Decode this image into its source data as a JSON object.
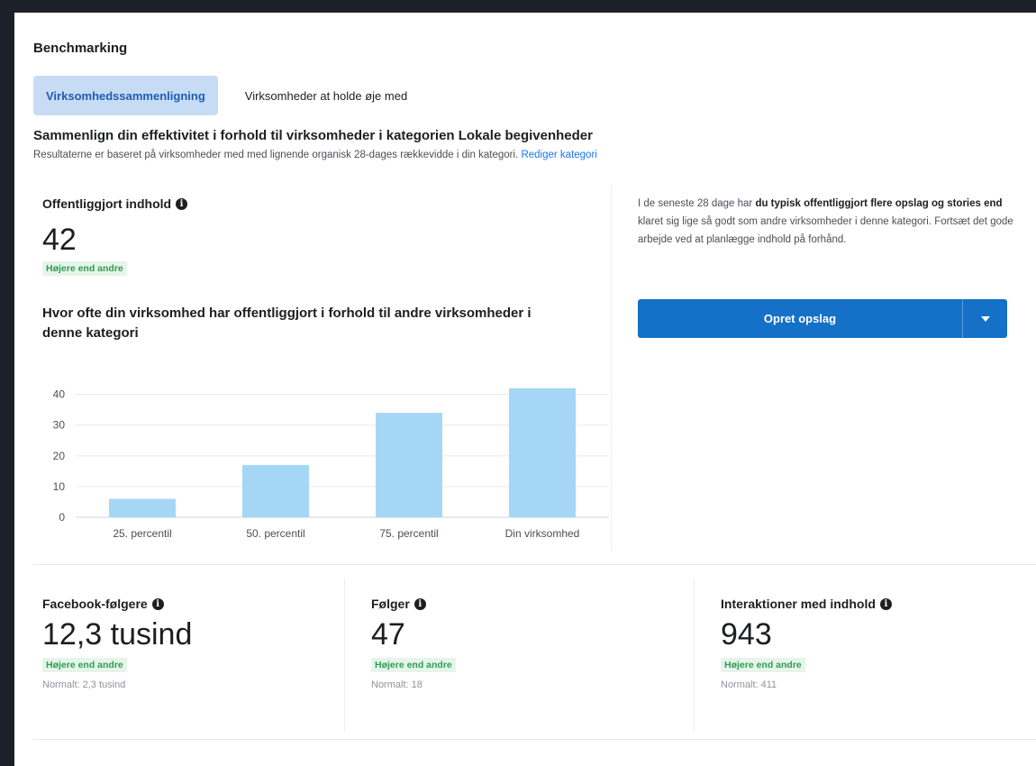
{
  "page": {
    "title": "Benchmarking",
    "tabs": [
      {
        "label": "Virksomhedssammenligning",
        "active": true
      },
      {
        "label": "Virksomheder at holde øje med",
        "active": false
      }
    ],
    "heading": "Sammenlign din effektivitet i forhold til virksomheder i kategorien Lokale begivenheder",
    "subheading": "Resultaterne er baseret på virksomheder med med lignende organisk 28-dages rækkevidde i din kategori.",
    "subheading_link": "Rediger kategori"
  },
  "published": {
    "label": "Offentliggjort indhold",
    "info_icon": "info-icon",
    "value": "42",
    "badge": "Højere end andre",
    "chart_title": "Hvor ofte din virksomhed har offentliggjort i forhold til andre virksomheder i denne kategori"
  },
  "chart_data": {
    "type": "bar",
    "categories": [
      "25. percentil",
      "50. percentil",
      "75. percentil",
      "Din virksomhed"
    ],
    "values": [
      6,
      17,
      34,
      42
    ],
    "yticks": [
      0,
      10,
      20,
      30,
      40
    ],
    "ylim": [
      0,
      44
    ],
    "bar_color": "#a6d6f5",
    "grid": true
  },
  "side": {
    "text_pre": "I de seneste 28 dage har ",
    "text_bold": "du typisk offentliggjort flere opslag og stories end",
    "text_post": " klaret sig lige så godt som andre virksomheder i denne kategori. Fortsæt det gode arbejde ved at planlægge indhold på forhånd.",
    "cta_label": "Opret opslag",
    "cta_icon": "caret-down-icon",
    "cta_color": "#1570c8"
  },
  "metrics": [
    {
      "label": "Facebook-følgere",
      "value": "12,3 tusind",
      "badge": "Højere end andre",
      "normal": "Normalt: 2,3 tusind"
    },
    {
      "label": "Følger",
      "value": "47",
      "badge": "Højere end andre",
      "normal": "Normalt: 18"
    },
    {
      "label": "Interaktioner med indhold",
      "value": "943",
      "badge": "Højere end andre",
      "normal": "Normalt: 411"
    }
  ],
  "colors": {
    "badge_bg": "#e6f4ea",
    "badge_text": "#2e9e4f",
    "link": "#1877f2",
    "active_tab_bg": "#c7dbf5"
  }
}
